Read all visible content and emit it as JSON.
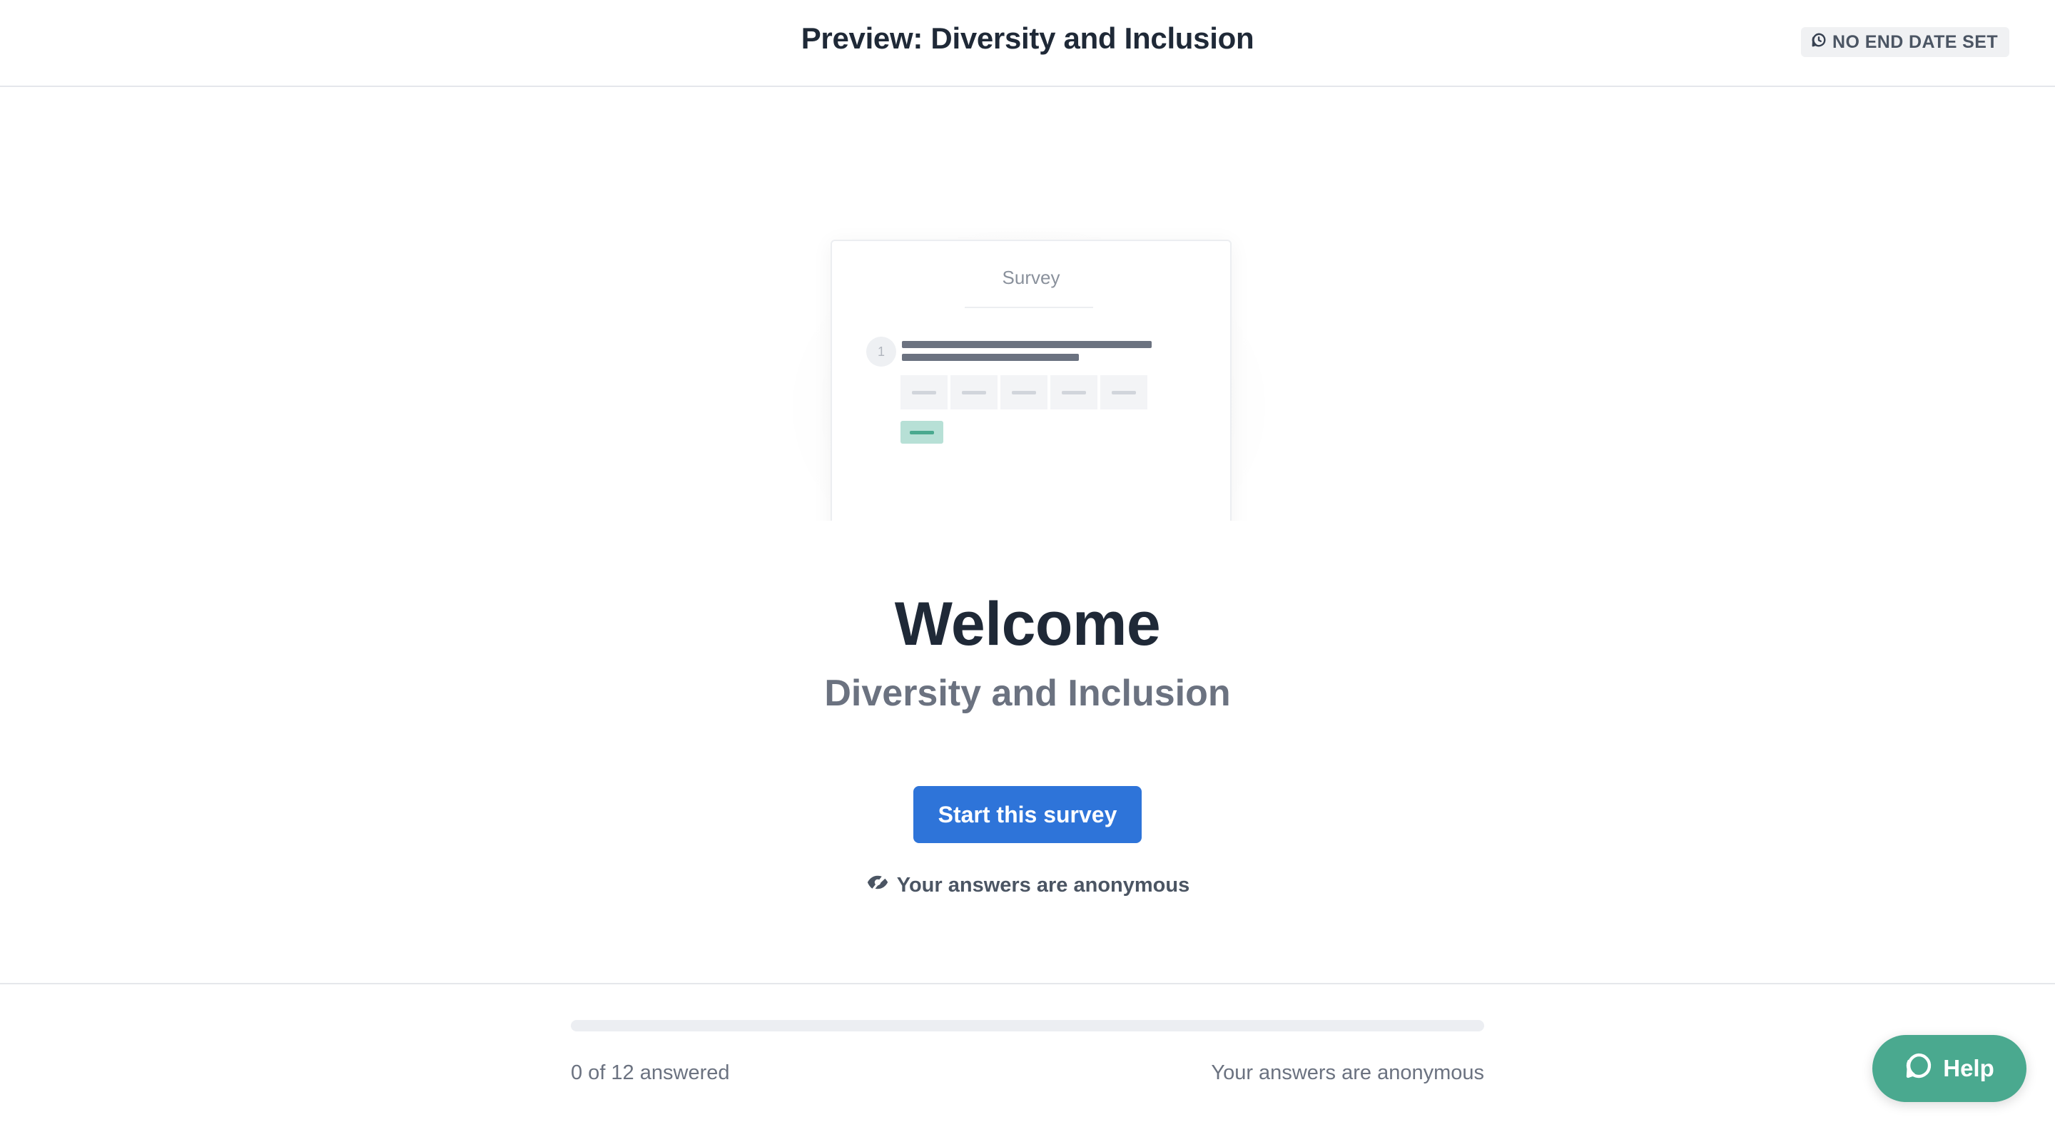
{
  "header": {
    "title": "Preview: Diversity and Inclusion",
    "end_date_label": "NO END DATE SET",
    "end_date_icon": "clock-icon"
  },
  "illustration": {
    "card_title": "Survey",
    "question_number": "1"
  },
  "welcome": {
    "title": "Welcome",
    "survey_name": "Diversity and Inclusion",
    "start_button_label": "Start this survey",
    "anonymous_note": "Your answers are anonymous",
    "anonymous_icon": "eye-off-icon"
  },
  "footer": {
    "answered_text": "0 of 12 answered",
    "answered": 0,
    "total": 12,
    "progress_fraction": 0,
    "anonymous_text": "Your answers are anonymous"
  },
  "help": {
    "label": "Help",
    "icon": "chat-bubble-icon",
    "color": "#4aa98f"
  },
  "colors": {
    "accent": "#2e74d9",
    "help": "#4aa98f",
    "text_primary": "#1f2937",
    "text_secondary": "#6b7280"
  }
}
